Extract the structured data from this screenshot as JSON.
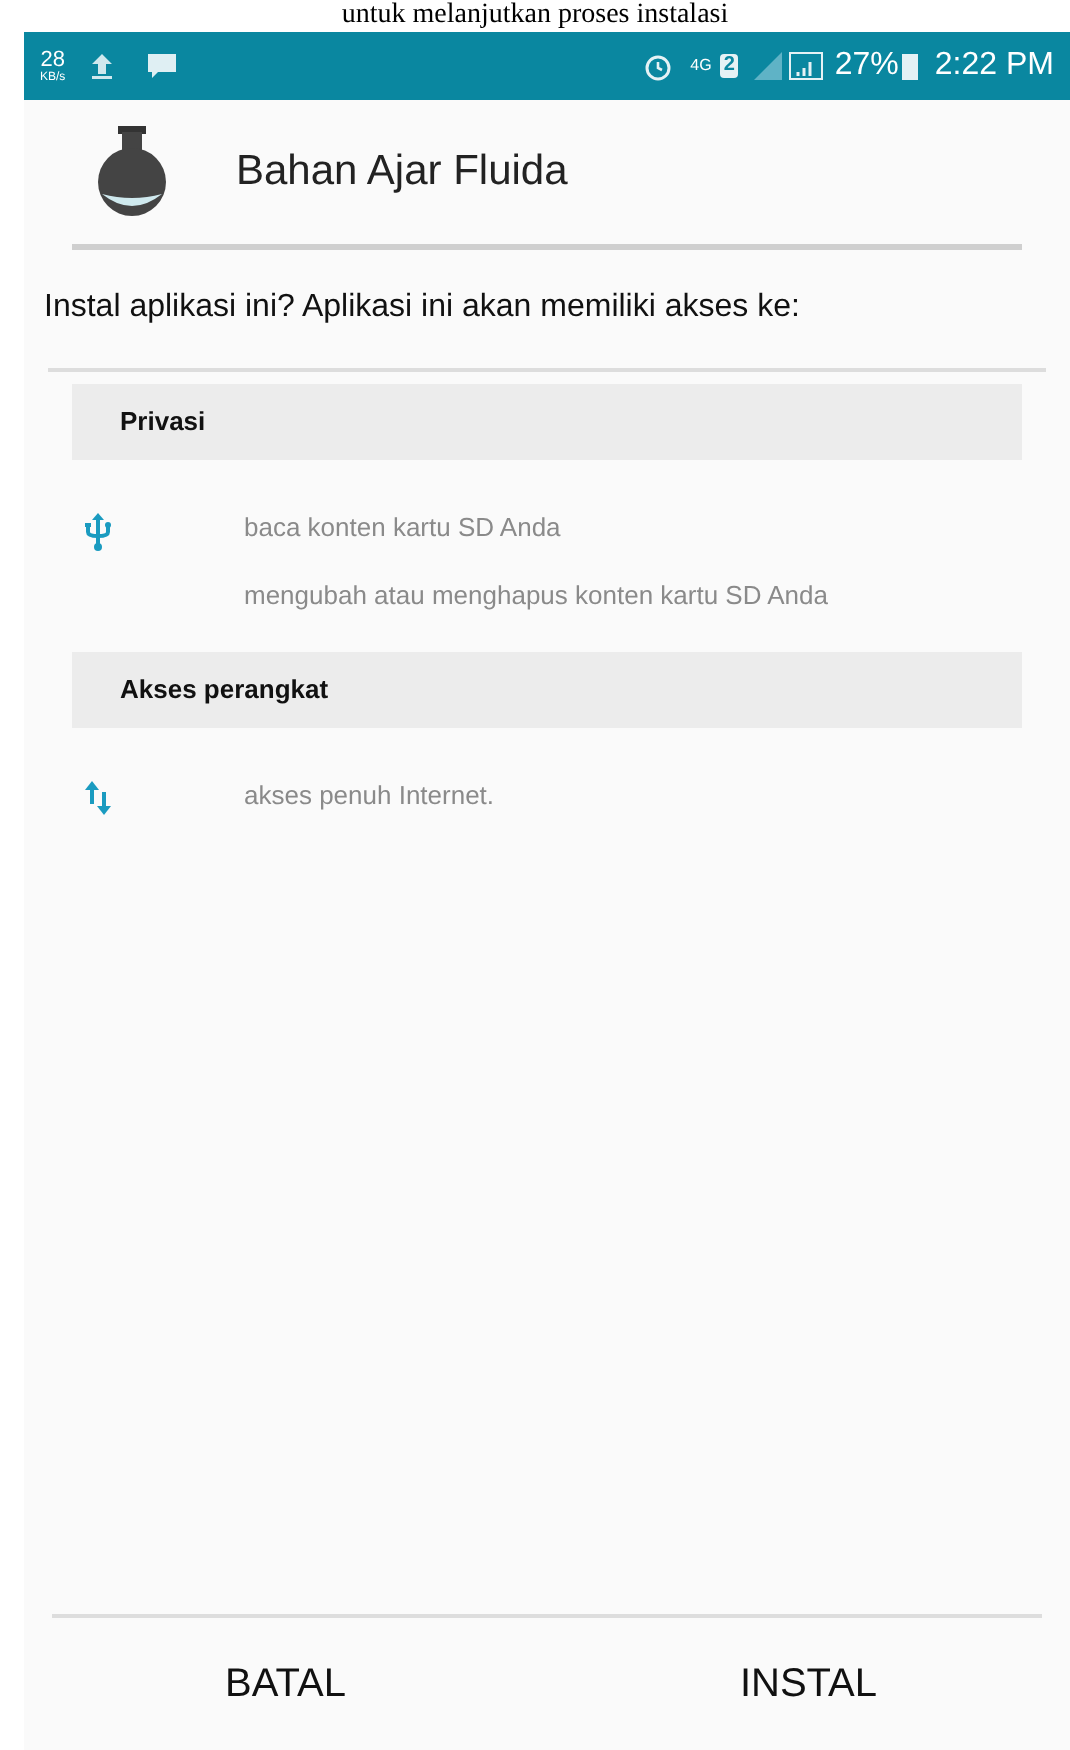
{
  "caption": "untuk melanjutkan proses instalasi",
  "status_bar": {
    "speed": "28",
    "speed_unit": "KB/s",
    "network": "4G",
    "sim": "2",
    "battery": "27%",
    "time": "2:22 PM"
  },
  "app": {
    "name": "Bahan Ajar Fluida"
  },
  "prompt": "Instal aplikasi ini? Aplikasi ini akan memiliki akses ke:",
  "groups": [
    {
      "title": "Privasi",
      "kind": "usb",
      "permissions": [
        "baca konten kartu SD Anda",
        "mengubah atau menghapus konten kartu SD Anda"
      ]
    },
    {
      "title": "Akses perangkat",
      "kind": "transfer",
      "permissions": [
        "akses penuh Internet."
      ]
    }
  ],
  "buttons": [
    "BATAL",
    "INSTAL"
  ]
}
